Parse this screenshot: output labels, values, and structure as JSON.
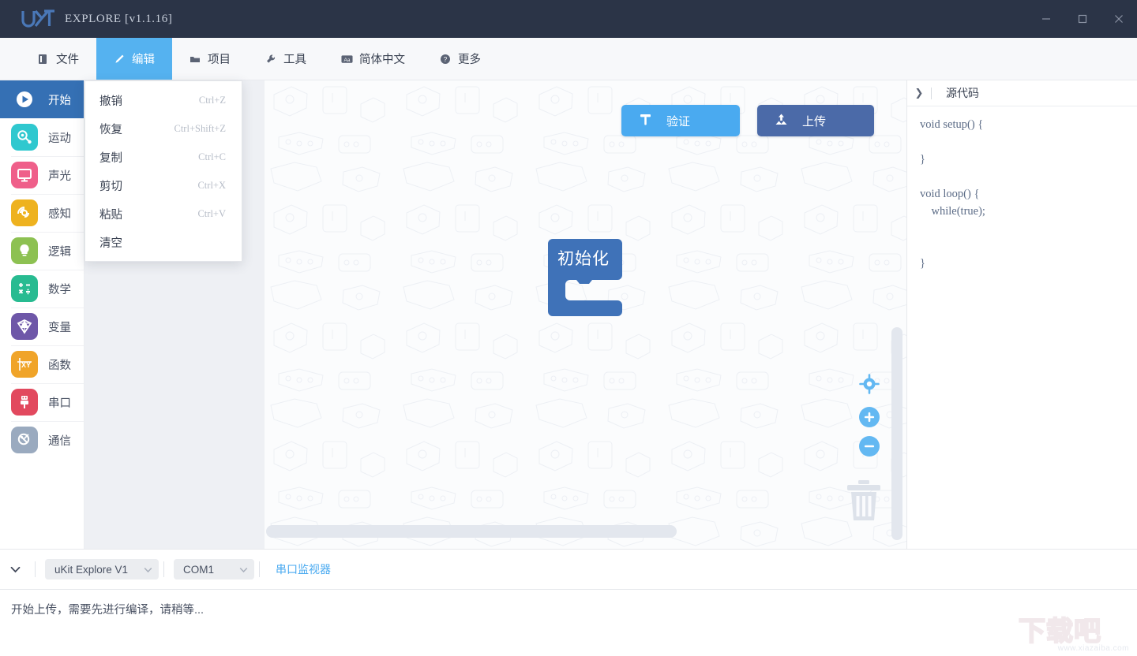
{
  "titlebar": {
    "logo_text": "UKIT",
    "app_title": "EXPLORE [v1.1.16]",
    "minimize": "–",
    "maximize": "□",
    "close": "✕"
  },
  "menubar": {
    "items": [
      {
        "label": "文件",
        "icon": "file-icon",
        "active": false
      },
      {
        "label": "编辑",
        "icon": "edit-pen-icon",
        "active": true
      },
      {
        "label": "项目",
        "icon": "folder-icon",
        "active": false
      },
      {
        "label": "工具",
        "icon": "wrench-icon",
        "active": false
      },
      {
        "label": "简体中文",
        "icon": "language-icon",
        "active": false
      },
      {
        "label": "更多",
        "icon": "help-circle-icon",
        "active": false
      }
    ]
  },
  "dropdown": {
    "items": [
      {
        "label": "撤销",
        "shortcut": "Ctrl+Z"
      },
      {
        "label": "恢复",
        "shortcut": "Ctrl+Shift+Z"
      },
      {
        "label": "复制",
        "shortcut": "Ctrl+C"
      },
      {
        "label": "剪切",
        "shortcut": "Ctrl+X"
      },
      {
        "label": "粘贴",
        "shortcut": "Ctrl+V"
      },
      {
        "label": "清空",
        "shortcut": ""
      }
    ]
  },
  "sidebar": {
    "items": [
      {
        "label": "开始",
        "icon": "play-circle-icon",
        "color": "#3570b4",
        "selected": true
      },
      {
        "label": "运动",
        "icon": "motion-icon",
        "color": "#2fc8cf",
        "selected": false
      },
      {
        "label": "声光",
        "icon": "screen-icon",
        "color": "#ef5f8a",
        "selected": false
      },
      {
        "label": "感知",
        "icon": "sensor-wave-icon",
        "color": "#eeb21f",
        "selected": false
      },
      {
        "label": "逻辑",
        "icon": "bulb-icon",
        "color": "#8dc152",
        "selected": false
      },
      {
        "label": "数学",
        "icon": "math-ops-icon",
        "color": "#28bb91",
        "selected": false
      },
      {
        "label": "变量",
        "icon": "variable-cube-icon",
        "color": "#6e57a8",
        "selected": false
      },
      {
        "label": "函数",
        "icon": "function-xy-icon",
        "color": "#f0a429",
        "selected": false
      },
      {
        "label": "串口",
        "icon": "usb-plug-icon",
        "color": "#e2495e",
        "selected": false
      },
      {
        "label": "通信",
        "icon": "satellite-icon",
        "color": "#9aaabf",
        "selected": false
      }
    ]
  },
  "canvas": {
    "verify_button": {
      "label": "验证",
      "icon": "hammer-icon",
      "color": "#4aaaf0"
    },
    "upload_button": {
      "label": "上传",
      "icon": "upload-arrow-icon",
      "color": "#4b6aa8"
    },
    "block": {
      "label": "初始化",
      "color": "#3f72b8"
    },
    "controls": [
      {
        "name": "center-target-icon",
        "glyph": "◉"
      },
      {
        "name": "zoom-in-icon",
        "glyph": "+"
      },
      {
        "name": "zoom-out-icon",
        "glyph": "−"
      }
    ],
    "trash_icon": "trash-icon"
  },
  "codepanel": {
    "toggle_icon": "chevron-right-icon",
    "title": "源代码",
    "code_lines": [
      "void setup() {",
      "",
      "}",
      "",
      "void loop() {",
      "    while(true);",
      "",
      "",
      "}"
    ]
  },
  "bottombar": {
    "caret_icon": "chevron-down-icon",
    "device": {
      "value": "uKit Explore V1",
      "caret": "⌄"
    },
    "port": {
      "value": "COM1",
      "caret": "⌄"
    },
    "serial_monitor_link": "串口监视器"
  },
  "console": {
    "message": "开始上传，需要先进行编译，请稍等..."
  },
  "watermark": {
    "cn": "下载吧",
    "url": "www.xiazaiba.com"
  }
}
